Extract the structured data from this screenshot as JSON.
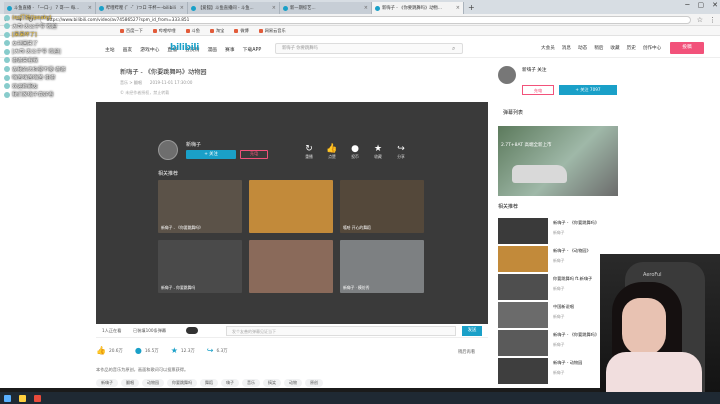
{
  "browser": {
    "tabs": [
      {
        "title": "斗鱼直播 - 「一口·」 7 哥·一 每..."
      },
      {
        "title": "哔哩哔哩 (゜-゜)つロ 干杯~--bilibili"
      },
      {
        "title": "【爱狐】斗鱼直播间 - 斗鱼..."
      },
      {
        "title": "新一期综艺..."
      },
      {
        "title": "新嗨子 - 《你要跳舞吗》动物..."
      }
    ],
    "new_tab": "+",
    "url": "https://www.bilibili.com/video/av74586527?spm_id_from=333.851",
    "bookmarks": [
      "百度一下",
      "哔哩哔哩",
      "斗鱼",
      "淘宝",
      "微博",
      "网易云音乐"
    ]
  },
  "site": {
    "logo": "bilibili",
    "nav_links": [
      "主站",
      "画友",
      "游戏中心",
      "直播",
      "会员购",
      "漫画",
      "赛事",
      "下载APP"
    ],
    "search_placeholder": "新嗨子 你要跳舞吗",
    "right_nav": [
      "大会员",
      "消息",
      "动态",
      "稍后",
      "收藏",
      "历史",
      "创作中心"
    ],
    "upload": "投稿"
  },
  "video": {
    "title": "新嗨子 - 《你要跳舞吗》动物园",
    "meta": "音乐 > 翻唱　　2019-11-01 17:30:00",
    "meta2": "© 未经作者授权，禁止转载",
    "player": {
      "uploader": "新嗨子",
      "follow": "+ 关注",
      "charge": "充电",
      "end_icons": [
        {
          "icon": "replay-icon",
          "glyph": "↻",
          "label": "重播"
        },
        {
          "icon": "like-icon",
          "glyph": "👍",
          "label": "点赞"
        },
        {
          "icon": "coin-icon",
          "glyph": "●",
          "label": "投币"
        },
        {
          "icon": "star-icon",
          "glyph": "★",
          "label": "收藏"
        },
        {
          "icon": "share-icon",
          "glyph": "↪",
          "label": "分享"
        }
      ],
      "related_head": "相关推荐",
      "related": [
        {
          "caption": "新嗨子 - 《你要跳舞吗》",
          "color": "#5b5248"
        },
        {
          "caption": "",
          "color": "#c28a3a"
        },
        {
          "caption": "嘻哈 开心的舞蹈",
          "color": "#54483a"
        },
        {
          "caption": "新嗨子 - 你要跳舞吗",
          "color": "#4a4a4a"
        },
        {
          "caption": "",
          "color": "#8a6a5a"
        },
        {
          "caption": "新嗨子 · 模仿秀",
          "color": "#7d8082"
        }
      ]
    },
    "controls": {
      "viewers": "1人正在看",
      "danmaku_count": "已装填100条弹幕",
      "danmaku_placeholder": "发个友善的弹幕见证当下",
      "send": "发送"
    },
    "actions": [
      {
        "icon": "thumb-icon",
        "glyph": "👍",
        "count": "20.6万"
      },
      {
        "icon": "coin-icon",
        "glyph": "●",
        "count": "16.5万"
      },
      {
        "icon": "star-icon",
        "glyph": "★",
        "count": "12.3万"
      },
      {
        "icon": "share-icon",
        "glyph": "↪",
        "count": "6.3万"
      }
    ],
    "share_text": "稍后再看",
    "description": "本作品的音乐为原创，画面和歌词可以投票获得。",
    "tags": [
      "新嗨子",
      "翻唱",
      "动物园",
      "你要跳舞吗",
      "舞蹈",
      "嗨子",
      "音乐",
      "搞笑",
      "动物",
      "原创"
    ]
  },
  "right_panel": {
    "uploader": "新嗨子 关注",
    "btn_charge": "充电",
    "btn_follow": "+ 关注 7097",
    "list_head": "弹幕列表",
    "ad_text": "2.7T+8AT 高端全新上市",
    "related_head": "相关推荐",
    "related": [
      {
        "title": "新嗨子 - 《你要跳舞吗》",
        "sub": "新嗨子",
        "color": "#3a3a3a"
      },
      {
        "title": "新嗨子 - 《动物园》",
        "sub": "新嗨子",
        "color": "#c28a3a"
      },
      {
        "title": "你要跳舞吗 ft.新嗨子",
        "sub": "新嗨子",
        "color": "#4e4e4e"
      },
      {
        "title": "中国新说唱",
        "sub": "新嗨子",
        "color": "#6b6b6b"
      },
      {
        "title": "新嗨子 - 《你要跳舞吗》",
        "sub": "新嗨子",
        "color": "#5a5a5a"
      },
      {
        "title": "新嗨子 - 动物园",
        "sub": "新嗨子",
        "color": "#3e3e3e"
      }
    ]
  },
  "overlay_chat": [
    {
      "text": "(es打扮(Ipeaky)",
      "color": "#ffd24a"
    },
    {
      "text": "大司·天公子爷 欢迎",
      "color": "#ffffff"
    },
    {
      "text": "[呆呆坏了]",
      "color": "#ffd24a"
    },
    {
      "text": "女神回来了",
      "color": "#ffffff"
    },
    {
      "text": "[大司·天公子爷 欢迎]",
      "color": "#ffffff"
    },
    {
      "text": "谢谢来看我",
      "color": "#ffffff"
    },
    {
      "text": "诶我的天你要不要·谢谢",
      "color": "#ffffff"
    },
    {
      "text": "嗨苦嗨苦嗨苦·谢谢",
      "color": "#ffffff"
    },
    {
      "text": "欢迎新朋友",
      "color": "#ffffff"
    },
    {
      "text": "我们家嗨子真好看",
      "color": "#ffffff"
    }
  ],
  "webcam": {
    "chair_brand": "AeroFul"
  }
}
